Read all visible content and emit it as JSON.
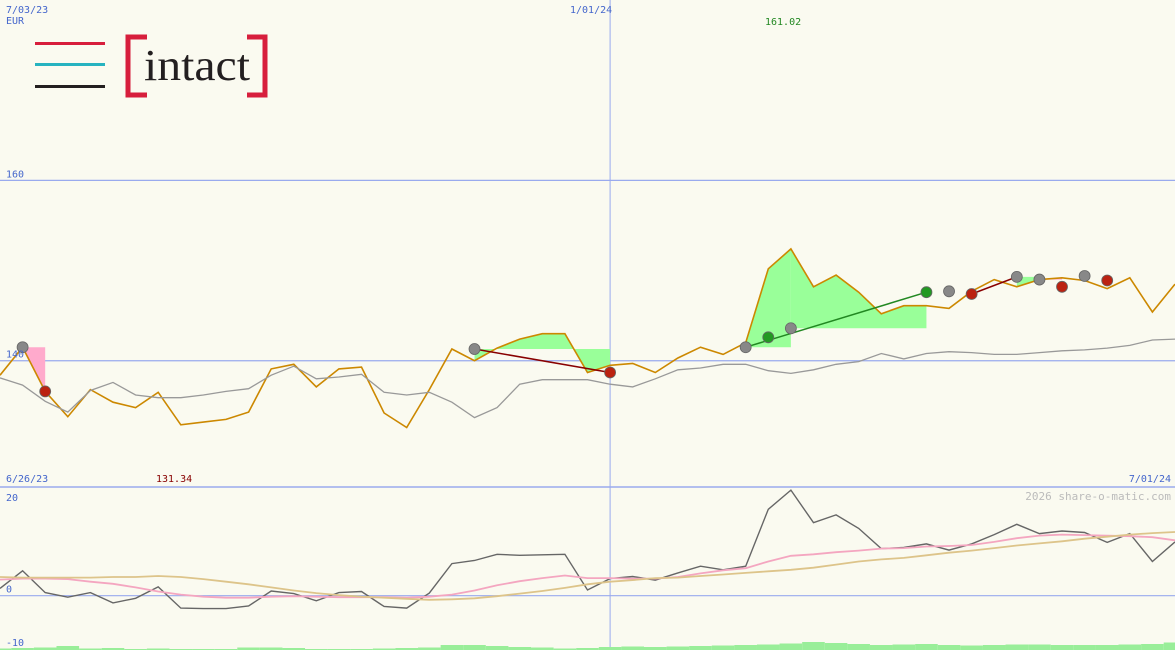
{
  "header": {
    "start_date": "7/03/23",
    "currency": "EUR",
    "mid_date": "1/01/24",
    "high_label": "161.02"
  },
  "logo": {
    "text": "intact"
  },
  "footer": {
    "low_date": "6/26/23",
    "low_label": "131.34",
    "end_date": "7/01/24",
    "copyright": "2026 share-o-matic.com"
  },
  "colors": {
    "price": "#cc8800",
    "benchmark": "#999999",
    "win_fill": "#99ff99",
    "loss_fill": "#ffaacc",
    "buy_line": "#228822",
    "sell_line": "#880000",
    "grid": "#99aaee",
    "logo_red": "#d71e3c",
    "logo_teal": "#26b3c0",
    "logo_black": "#231f20"
  },
  "chart_data": [
    {
      "type": "line",
      "title": "",
      "x_start": "2023-06-26",
      "x_end": "2024-07-01",
      "interval": "weekly",
      "y_ticks": [
        140,
        160
      ],
      "y_tick_labels": [
        "140",
        "160"
      ],
      "ylim": [
        126,
        180
      ],
      "grid": true,
      "series": [
        {
          "values": [
            138.4,
            141.5,
            136.6,
            133.8,
            136.8,
            135.4,
            134.8,
            136.5,
            132.9,
            133.2,
            133.5,
            134.3,
            139.1,
            139.6,
            137.1,
            139.1,
            139.3,
            134.2,
            132.6,
            136.8,
            141.3,
            140.0,
            141.4,
            142.4,
            143.0,
            143.0,
            138.7,
            139.5,
            139.7,
            138.7,
            140.3,
            141.5,
            140.7,
            142.0,
            150.2,
            152.4,
            148.2,
            149.5,
            147.6,
            145.2,
            146.1,
            146.1,
            145.8,
            147.7,
            149.0,
            148.2,
            149.0,
            149.2,
            148.9,
            148.0,
            149.2,
            145.4,
            148.5
          ]
        },
        {
          "values": [
            138.1,
            137.3,
            135.5,
            134.3,
            136.7,
            137.6,
            136.2,
            135.9,
            135.9,
            136.2,
            136.6,
            136.9,
            138.4,
            139.4,
            138.0,
            138.2,
            138.5,
            136.5,
            136.2,
            136.5,
            135.4,
            133.7,
            134.8,
            137.4,
            137.9,
            137.9,
            137.9,
            137.4,
            137.1,
            138.0,
            139.0,
            139.2,
            139.6,
            139.6,
            138.9,
            138.6,
            139.0,
            139.6,
            139.9,
            140.8,
            140.2,
            140.8,
            141.0,
            140.9,
            140.7,
            140.7,
            140.9,
            141.1,
            141.2,
            141.4,
            141.7,
            142.3,
            142.4
          ]
        }
      ],
      "signals": [
        {
          "date": "2023-07-03",
          "kind": "hold",
          "price": 141.5
        },
        {
          "date": "2023-07-10",
          "kind": "sell",
          "price": 136.6
        },
        {
          "date": "2023-11-20",
          "kind": "hold",
          "price": 141.3
        },
        {
          "date": "2024-01-01",
          "kind": "sell",
          "price": 138.7
        },
        {
          "date": "2024-02-12",
          "kind": "hold",
          "price": 141.5
        },
        {
          "date": "2024-02-19",
          "kind": "buy",
          "price": 142.6
        },
        {
          "date": "2024-02-26",
          "kind": "hold",
          "price": 143.6
        },
        {
          "date": "2024-04-08",
          "kind": "buy",
          "price": 147.6
        },
        {
          "date": "2024-04-15",
          "kind": "hold",
          "price": 147.7
        },
        {
          "date": "2024-04-22",
          "kind": "sell",
          "price": 147.4
        },
        {
          "date": "2024-05-06",
          "kind": "hold",
          "price": 149.3
        },
        {
          "date": "2024-05-13",
          "kind": "hold",
          "price": 149.0
        },
        {
          "date": "2024-05-20",
          "kind": "sell",
          "price": 148.2
        },
        {
          "date": "2024-05-27",
          "kind": "hold",
          "price": 149.4
        },
        {
          "date": "2024-06-03",
          "kind": "sell",
          "price": 148.9
        }
      ]
    },
    {
      "type": "line",
      "title": "",
      "y_ticks": [
        -10,
        0,
        20
      ],
      "y_tick_labels": [
        "-10",
        "0",
        "20"
      ],
      "ylim": [
        -10.5,
        21
      ],
      "grid": true,
      "series": [
        {
          "values": [
            1.4,
            4.8,
            0.6,
            -0.3,
            0.6,
            -1.4,
            -0.5,
            1.7,
            -2.4,
            -2.5,
            -2.5,
            -2.0,
            0.9,
            0.4,
            -1.0,
            0.6,
            0.8,
            -2.1,
            -2.4,
            0.5,
            6.2,
            6.8,
            8.0,
            7.8,
            7.9,
            8.0,
            1.1,
            3.3,
            3.7,
            3.0,
            4.4,
            5.7,
            5.0,
            5.7,
            16.7,
            20.4,
            14.1,
            15.6,
            13.0,
            9.1,
            9.3,
            10.0,
            8.8,
            10.0,
            11.8,
            13.8,
            12.0,
            12.5,
            12.2,
            10.3,
            12.0,
            6.6,
            10.4
          ]
        },
        {
          "values": [
            3.1,
            3.3,
            3.3,
            3.2,
            2.7,
            2.3,
            1.6,
            0.8,
            0.2,
            -0.2,
            -0.4,
            -0.4,
            -0.2,
            -0.1,
            -0.2,
            -0.3,
            -0.3,
            -0.3,
            -0.4,
            -0.2,
            0.2,
            1.0,
            2.0,
            2.8,
            3.4,
            3.9,
            3.4,
            3.4,
            3.3,
            3.3,
            3.6,
            4.3,
            4.9,
            5.3,
            6.6,
            7.7,
            8.0,
            8.4,
            8.7,
            9.1,
            9.2,
            9.5,
            9.6,
            9.8,
            10.4,
            11.1,
            11.6,
            11.8,
            11.7,
            11.6,
            11.5,
            11.3,
            10.7
          ]
        },
        {
          "values": [
            3.6,
            3.5,
            3.5,
            3.5,
            3.5,
            3.6,
            3.6,
            3.8,
            3.6,
            3.2,
            2.7,
            2.2,
            1.6,
            1.0,
            0.5,
            0.1,
            -0.2,
            -0.4,
            -0.6,
            -0.8,
            -0.7,
            -0.5,
            -0.1,
            0.4,
            0.9,
            1.5,
            2.2,
            2.7,
            3.0,
            3.4,
            3.5,
            3.8,
            4.1,
            4.4,
            4.7,
            5.0,
            5.4,
            6.0,
            6.6,
            7.0,
            7.3,
            7.8,
            8.3,
            8.7,
            9.2,
            9.7,
            10.1,
            10.5,
            11.0,
            11.4,
            11.8,
            12.1,
            12.3
          ]
        }
      ],
      "volume_bars": [
        0.3,
        0.4,
        0.5,
        0.8,
        0.3,
        0.4,
        0.2,
        0.3,
        0.1,
        0.0,
        0.2,
        0.5,
        0.5,
        0.4,
        0.2,
        0.1,
        0.2,
        0.3,
        0.4,
        0.5,
        1.0,
        1.0,
        0.8,
        0.6,
        0.5,
        0.3,
        0.4,
        0.6,
        0.7,
        0.6,
        0.7,
        0.8,
        0.9,
        1.0,
        1.1,
        1.3,
        1.6,
        1.4,
        1.2,
        1.0,
        1.1,
        1.2,
        1.0,
        0.9,
        1.0,
        1.1,
        1.1,
        1.0,
        1.0,
        1.0,
        1.1,
        1.2,
        1.5
      ]
    }
  ]
}
